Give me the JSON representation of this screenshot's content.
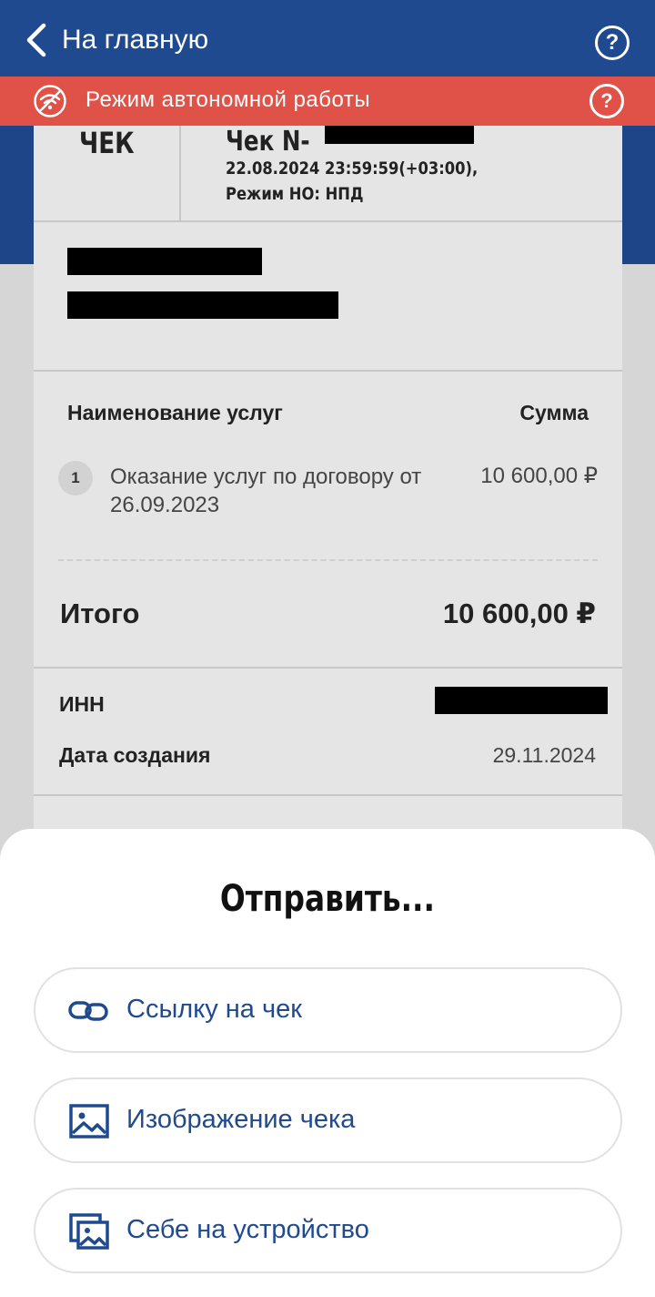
{
  "header": {
    "back_label": "На главную"
  },
  "banner": {
    "text": "Режим автономной работы"
  },
  "receipt": {
    "type_label": "ЧЕК",
    "number_label": "Чек N-",
    "datetime": "22.08.2024 23:59:59(+03:00),",
    "tax_mode": "Режим НО: НПД",
    "columns": {
      "name": "Наименование услуг",
      "sum": "Сумма"
    },
    "items": [
      {
        "number": "1",
        "description": "Оказание услуг по договору от 26.09.2023",
        "amount": "10 600,00 ₽"
      }
    ],
    "total_label": "Итого",
    "total_value": "10 600,00 ₽",
    "inn_label": "ИНН",
    "created_label": "Дата создания",
    "created_value": "29.11.2024"
  },
  "sheet": {
    "title": "Отправить...",
    "options": [
      {
        "label": "Ссылку на чек",
        "icon": "link-icon"
      },
      {
        "label": "Изображение чека",
        "icon": "image-icon"
      },
      {
        "label": "Себе на устройство",
        "icon": "gallery-icon"
      }
    ]
  },
  "colors": {
    "brand_blue": "#1f4a90",
    "banner_red": "#e05248",
    "card_bg": "#e5e5e5"
  }
}
